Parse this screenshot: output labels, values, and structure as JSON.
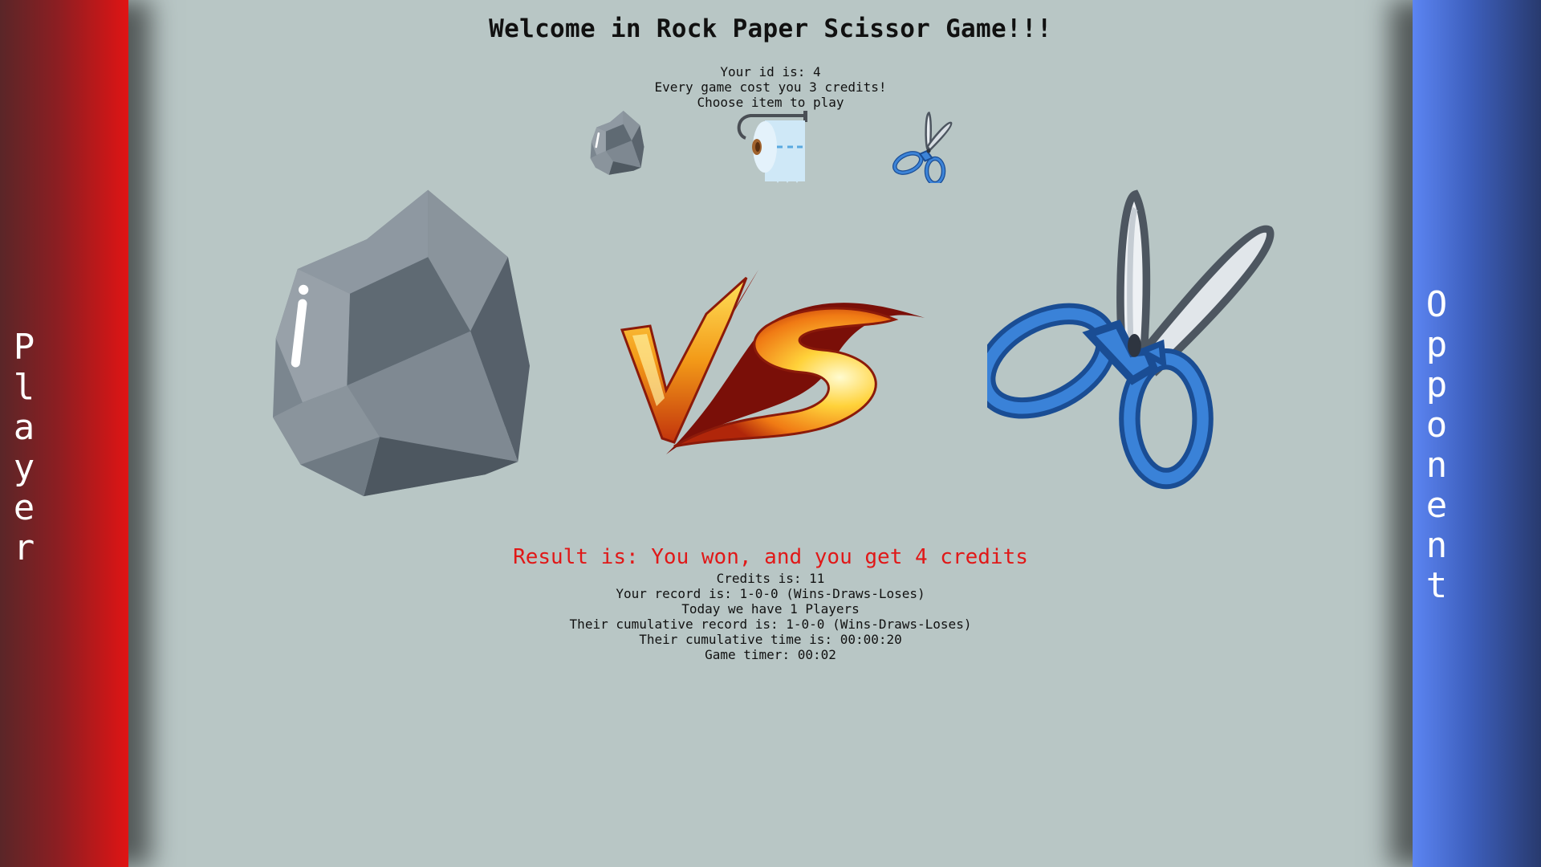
{
  "sidebar": {
    "player_label": "Player",
    "opponent_label": "Opponent"
  },
  "header": {
    "title": "Welcome in Rock Paper Scissor Game!!!"
  },
  "info": {
    "id_line": "Your id is: 4",
    "cost_line": "Every game cost you 3 credits!",
    "choose_line": "Choose item to play"
  },
  "choices": [
    {
      "name": "rock",
      "icon": "rock-icon"
    },
    {
      "name": "paper",
      "icon": "toilet-paper-icon"
    },
    {
      "name": "scissors",
      "icon": "scissors-icon"
    }
  ],
  "match": {
    "player_choice": "rock",
    "opponent_choice": "scissors",
    "vs_icon": "vs-flame-icon"
  },
  "result": {
    "text": "Result is: You won, and you get 4 credits",
    "color": "#e01818"
  },
  "stats": {
    "credits": "Credits is: 11",
    "record": "Your record is: 1-0-0 (Wins-Draws-Loses)",
    "players_today": "Today we have 1 Players",
    "cumulative_record": "Their cumulative record is: 1-0-0 (Wins-Draws-Loses)",
    "cumulative_time": "Their cumulative time is: 00:00:20",
    "game_timer": "Game timer: 00:02"
  },
  "colors": {
    "player": "#e01414",
    "opponent": "#5c85f2",
    "background": "#b8c6c5"
  }
}
